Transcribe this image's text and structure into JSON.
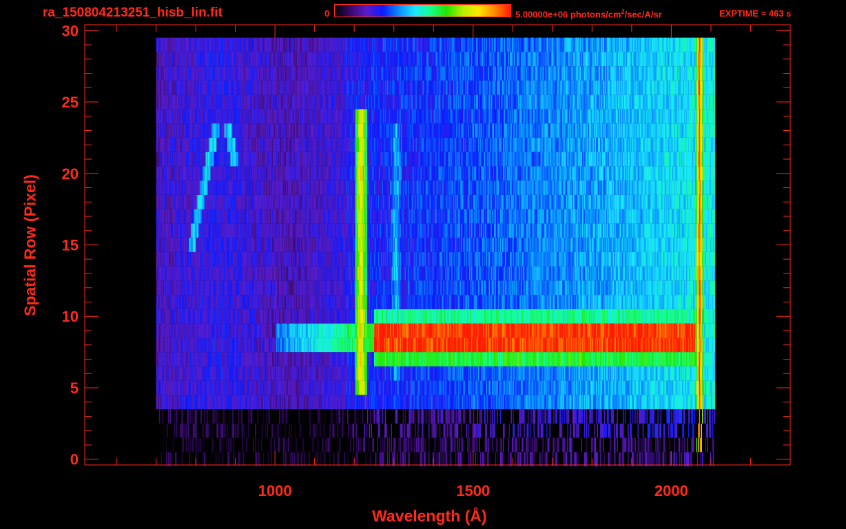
{
  "header": {
    "file_title": "ra_150804213251_hisb_lin.fit",
    "colorbar_min": "0",
    "colorbar_max_prefix": "5.00000e+06 photons/cm",
    "colorbar_max_exp": "2",
    "colorbar_max_suffix": "/sec/A/sr",
    "exptime": "EXPTIME = 463 s"
  },
  "colors": {
    "axis": "#ff2a1a",
    "colormap": [
      "#000000",
      "#3a0a6e",
      "#5a1cc8",
      "#0a1cff",
      "#0a8cff",
      "#19e6ff",
      "#14ff8c",
      "#22e600",
      "#b4f000",
      "#ffe600",
      "#ff8c00",
      "#ff1a00"
    ]
  },
  "chart_data": {
    "type": "heatmap",
    "title": "ra_150804213251_hisb_lin.fit",
    "xlabel": "Wavelength (Å)",
    "ylabel": "Spatial Row (Pixel)",
    "xlim": [
      520,
      2300
    ],
    "ylim": [
      -0.4,
      30.4
    ],
    "x_ticks": [
      1000,
      1500,
      2000
    ],
    "x_minor_step": 100,
    "y_ticks": [
      0,
      5,
      10,
      15,
      20,
      25,
      30
    ],
    "y_minor_step": 1,
    "grid": false,
    "colorbar": {
      "min": 0,
      "max": 5000000,
      "units": "photons/cm^2/sec/A/sr",
      "position": "top"
    },
    "data_extent": {
      "wavelength": [
        700,
        2110
      ],
      "rows": [
        0,
        30
      ]
    },
    "features": [
      {
        "type": "emission_line",
        "wavelength": 1216,
        "rows": [
          5,
          25
        ],
        "peak_level": 0.82
      },
      {
        "type": "emission_line",
        "wavelength": 1304,
        "rows": [
          6,
          24
        ],
        "peak_level": 0.42
      },
      {
        "type": "continuum_band",
        "wavelength_range": [
          1250,
          2060
        ],
        "rows": [
          8,
          10
        ],
        "peak_level": 1.0
      },
      {
        "type": "continuum_band",
        "wavelength_range": [
          1250,
          2060
        ],
        "rows": [
          10,
          11
        ],
        "peak_level": 0.56
      },
      {
        "type": "continuum_band",
        "wavelength_range": [
          1250,
          2060
        ],
        "rows": [
          7,
          8
        ],
        "peak_level": 0.62
      },
      {
        "type": "arc_structure",
        "wavelength_range": [
          800,
          930
        ],
        "rows": [
          15,
          24
        ],
        "peak_level": 0.42
      },
      {
        "type": "edge_line",
        "wavelength": 2070,
        "rows": [
          1,
          30
        ],
        "peak_level": 0.98
      }
    ]
  }
}
